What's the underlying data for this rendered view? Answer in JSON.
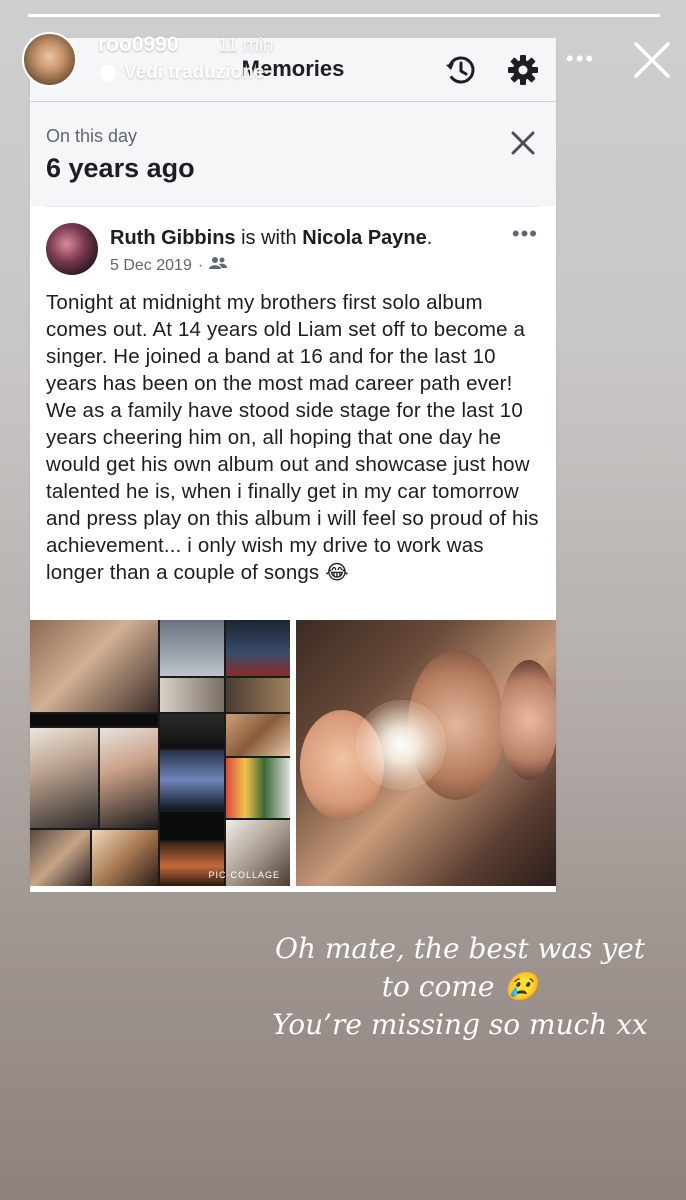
{
  "story": {
    "username": "roo0990",
    "time_ago": "11 min",
    "translate_label": "Vedi traduzione",
    "progress": 1.0
  },
  "memories": {
    "title": "Memories",
    "header_icons": [
      "history-icon",
      "gear-icon"
    ],
    "on_this_day_label": "On this day",
    "years_ago": "6 years ago"
  },
  "post": {
    "author": "Ruth Gibbins",
    "with_text": "is with",
    "tagged": "Nicola Payne",
    "date": "5 Dec 2019",
    "text": "Tonight at midnight my brothers first solo album comes out. At 14 years old Liam set off to become a singer. He joined a band at 16 and for the last 10 years has been on the most mad career path ever! We as a family have stood side stage for the last 10 years cheering him on, all hoping that one day he would get his own album out and showcase just how talented he is, when i finally get in my car tomorrow and press play on this album i will feel so proud of his achievement... i only wish my drive to work was longer than a couple of songs",
    "emoji": "😂",
    "collage_label": "PIC·COLLAGE"
  },
  "caption": {
    "line1": "Oh mate, the best was yet",
    "line2": "to come 😢",
    "line3": "You’re missing so much xx"
  }
}
